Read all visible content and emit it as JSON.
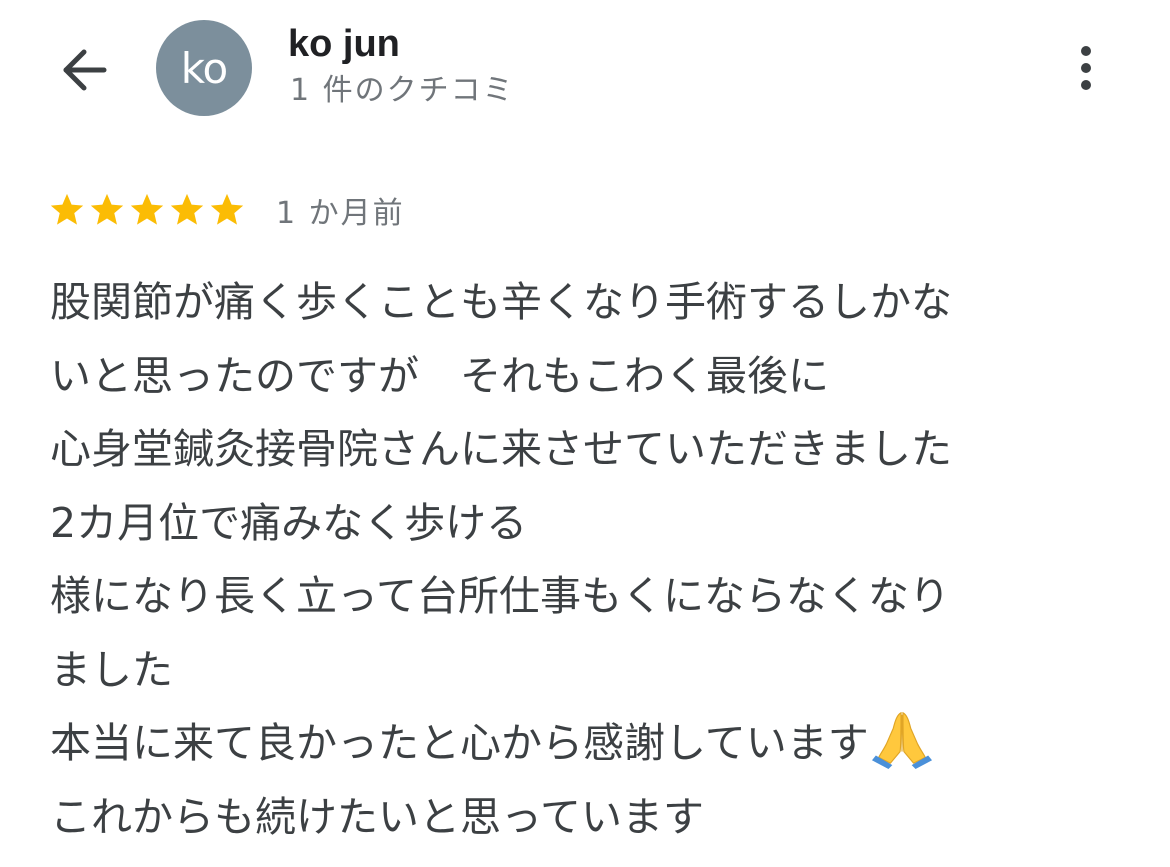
{
  "header": {
    "user_name": "ko jun",
    "avatar_initials": "ko",
    "review_count": "1 件のクチコミ",
    "back_icon": "arrow-back-icon",
    "more_icon": "more-vert-icon"
  },
  "review": {
    "rating": 5,
    "max_rating": 5,
    "date": "1 か月前",
    "lines": [
      "股関節が痛く歩くことも辛くなり手術するしかな",
      "いと思ったのですが　それもこわく最後に",
      "心身堂鍼灸接骨院さんに来させていただきました",
      "2カ月位で痛みなく歩ける",
      "様になり長く立って台所仕事もくにならなくなり",
      "ました",
      "本当に来て良かったと心から感謝しています",
      "これからも続けたいと思っています"
    ],
    "emoji": "folded-hands-emoji"
  },
  "colors": {
    "star": "#fbbc04",
    "avatar_bg": "#7c8f9c",
    "secondary_text": "#70757a",
    "body_text": "#3c4043"
  }
}
